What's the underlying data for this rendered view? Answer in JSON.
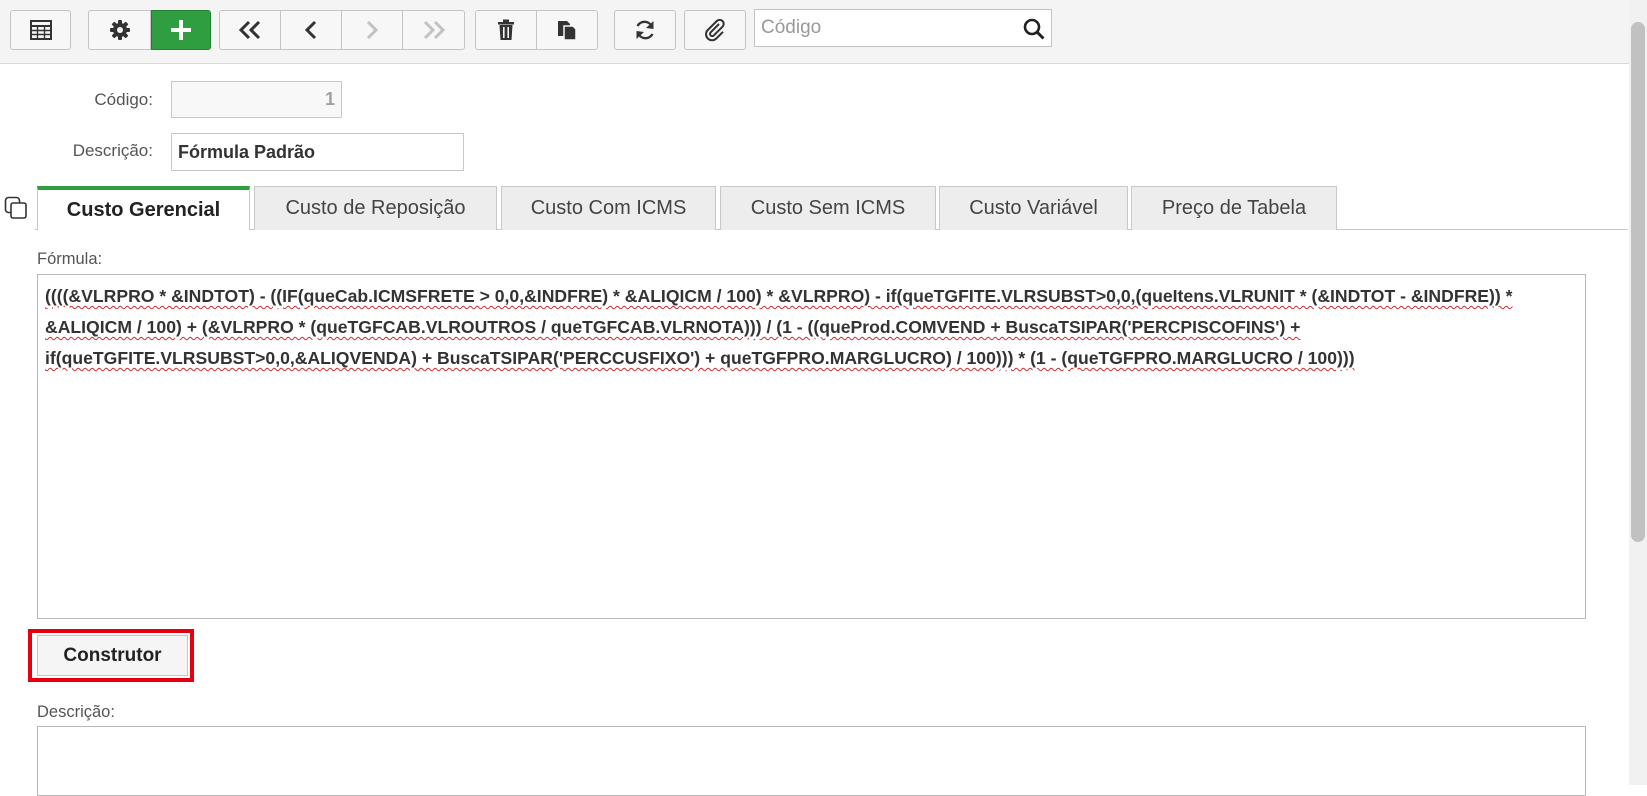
{
  "toolbar": {
    "search_placeholder": "Código"
  },
  "form": {
    "codigo_label": "Código:",
    "codigo_value": "1",
    "descricao_label": "Descrição:",
    "descricao_value": "Fórmula Padrão"
  },
  "tabs": [
    {
      "label": "Custo Gerencial",
      "active": true
    },
    {
      "label": "Custo de Reposição"
    },
    {
      "label": "Custo Com ICMS"
    },
    {
      "label": "Custo Sem ICMS"
    },
    {
      "label": "Custo Variável"
    },
    {
      "label": "Preço de Tabela"
    }
  ],
  "formula": {
    "label": "Fórmula:",
    "text": "((((&VLRPRO * &INDTOT) - ((IF(queCab.ICMSFRETE > 0,0,&INDFRE) * &ALIQICM / 100) * &VLRPRO) - if(queTGFITE.VLRSUBST>0,0,(queItens.VLRUNIT * (&INDTOT - &INDFRE)) * &ALIQICM / 100) + (&VLRPRO * (queTGFCAB.VLROUTROS / queTGFCAB.VLRNOTA))) / (1 - ((queProd.COMVEND + BuscaTSIPAR('PERCPISCOFINS') + if(queTGFITE.VLRSUBST>0,0,&ALIQVENDA) + BuscaTSIPAR('PERCCUSFIXO') + queTGFPRO.MARGLUCRO) / 100))) * (1 -  (queTGFPRO.MARGLUCRO / 100)))"
  },
  "construtor_label": "Construtor",
  "descricao2_label": "Descrição:",
  "colors": {
    "accent": "#2f9e41",
    "highlight": "#e4000f"
  }
}
